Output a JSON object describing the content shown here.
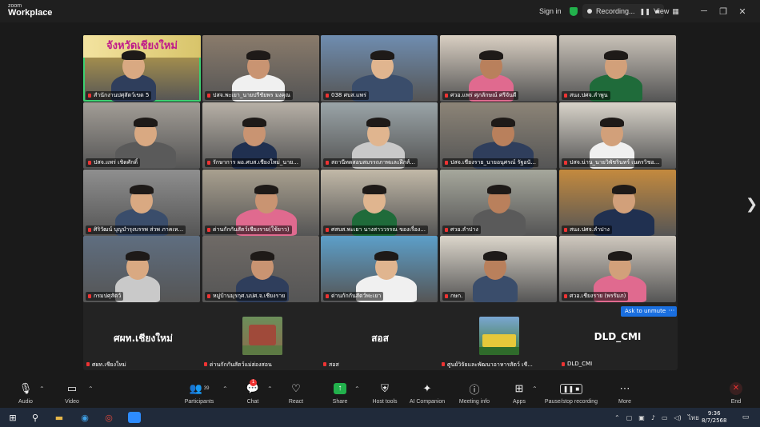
{
  "app": {
    "logo_line1": "zoom",
    "logo_line2": "Workplace",
    "sign_in": "Sign in",
    "recording": "Recording...",
    "view": "View"
  },
  "tiles": [
    {
      "label": "สำนักงานปศุสัตว์เขต 5",
      "bg": "#c9a94a",
      "active": true,
      "banner": "จังหวัดเชียงใหม่"
    },
    {
      "label": "ปสจ.พะเยา_นายปรีชัยพร มงคุณ",
      "bg": "#8a7b6b"
    },
    {
      "label": "038 ศบส.แพร่",
      "bg": "#6f8db0"
    },
    {
      "label": "ศวอ.แพร่ ศุภลักษณ์ ศรีจันดี",
      "bg": "#d9cfc2"
    },
    {
      "label": "สนง.ปศจ.ลำพูน",
      "bg": "#c9c2b8"
    },
    {
      "label": "ปสจ.แพร่ เชิดศักดิ์",
      "bg": "#a29d96"
    },
    {
      "label": "รักษาการ ผอ.ศบส.เชียงใหม่_นาย...",
      "bg": "#b7b0a6"
    },
    {
      "label": "สถานีทดสอบสมรรถภาพและฝึกส์...",
      "bg": "#9aa4a8"
    },
    {
      "label": "ปสจ.เชียงราย_นายอนุศรณ์ รัฐอนั...",
      "bg": "#8c8477"
    },
    {
      "label": "ปสจ.น่าน_นายวิพัชรินทร์ เนตรวิชอ...",
      "bg": "#d8d3c9"
    },
    {
      "label": "ศิริวัฒน์ บุญบำรุงบรรพ ส่วพ ภาคเห...",
      "bg": "#8f8f8f"
    },
    {
      "label": "ด่านกักกันสัตว์เชียงราย(ใช้ยาว)",
      "bg": "#a9a08f"
    },
    {
      "label": "ศสบส.พะเยา นางสาววรรณ ของเรื่อง...",
      "bg": "#c2b9a8"
    },
    {
      "label": "ศวอ.ลำปาง",
      "bg": "#a6a89c"
    },
    {
      "label": "สนง.ปศจ.ลำปาง",
      "bg": "#c48a3e"
    },
    {
      "label": "กรมปศุสัตว์",
      "bg": "#5f6e80"
    },
    {
      "label": "หมู่บ้านมุรกุศ.นปศ.จ.เชียงราย",
      "bg": "#6f6a66"
    },
    {
      "label": "ด่านกักกันสัตว์พะเยา",
      "bg": "#5c9fc9"
    },
    {
      "label": "กษก.",
      "bg": "#dcd6cb"
    },
    {
      "label": "ศวอ.เชียงราย (พรรัมภ)",
      "bg": "#cfc8be"
    }
  ],
  "bottom": [
    {
      "name": "ศผท.เชียงใหม่",
      "label": "ศผท.เชียงใหม่"
    },
    {
      "name": "",
      "label": "ด่านกักกันสัตว์แม่ฮ่องสอน"
    },
    {
      "name": "สอส",
      "label": "สอส"
    },
    {
      "name": "",
      "label": "ศูนย์วิจัยและพัฒนาอาหารสัตว์ เชี..."
    },
    {
      "name": "DLD_CMI",
      "label": "DLD_CMI"
    }
  ],
  "ask_unmute": "Ask to unmute",
  "more": "···",
  "toolbar": {
    "audio": "Audio",
    "video": "Video",
    "participants": "Participants",
    "participants_count": "39",
    "chat": "Chat",
    "chat_badge": "1",
    "react": "React",
    "share": "Share",
    "host_tools": "Host tools",
    "ai": "AI Companion",
    "meeting_info": "Meeting info",
    "apps": "Apps",
    "pause_stop": "Pause/stop recording",
    "more": "More",
    "end": "End"
  },
  "taskbar": {
    "lang": "ไทย",
    "time": "9:36",
    "date": "8/7/2568"
  }
}
